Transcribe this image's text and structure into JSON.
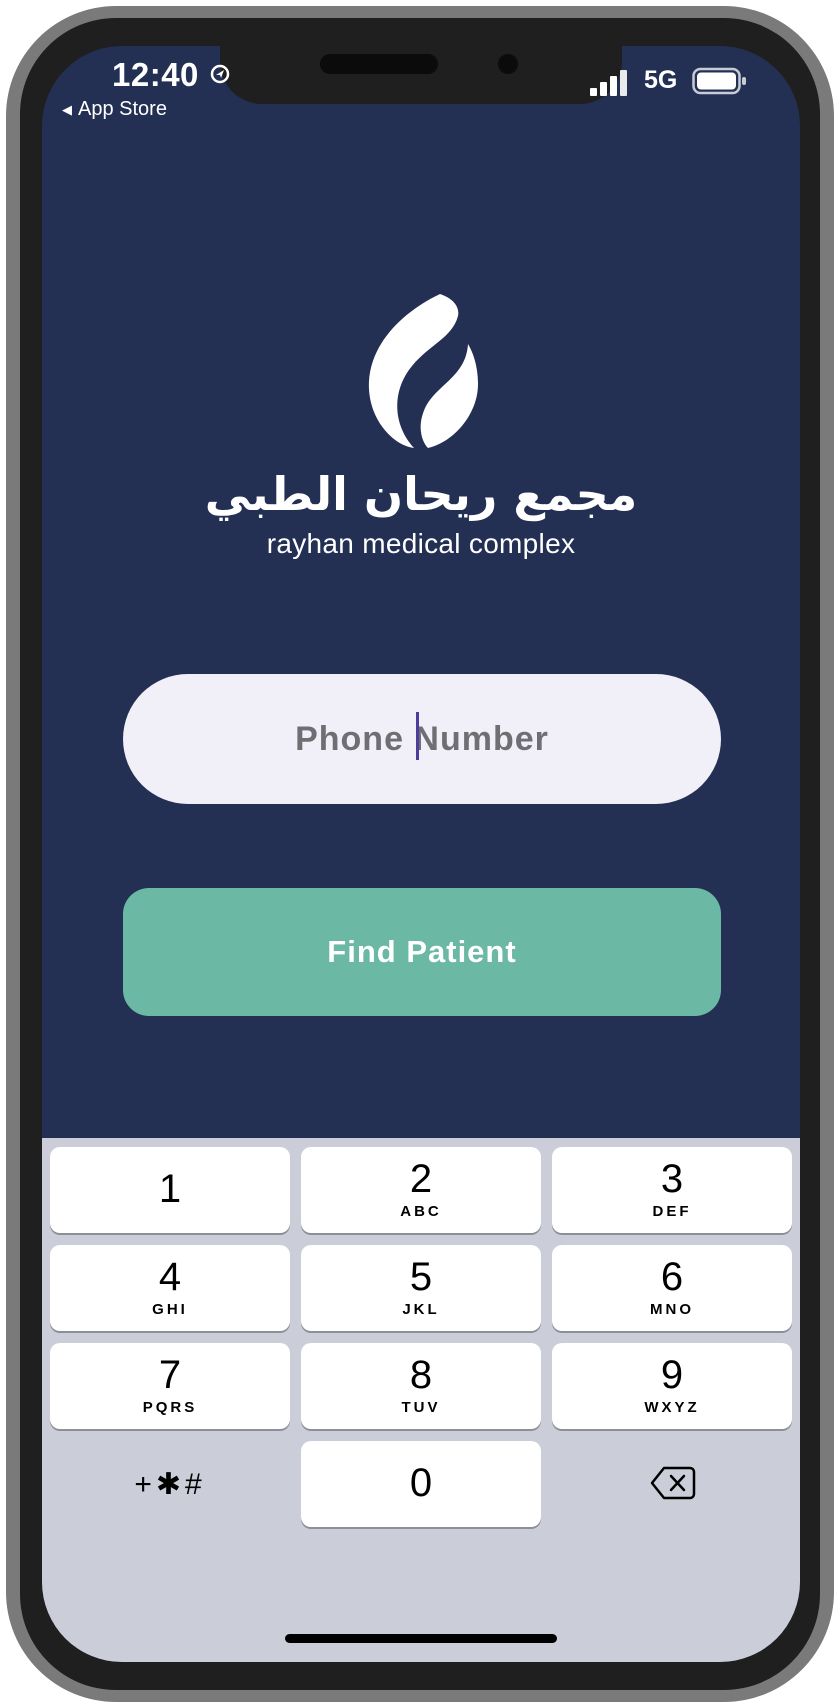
{
  "status_bar": {
    "time": "12:40",
    "back_label": "App Store",
    "network": "5G",
    "icons": [
      "location-icon",
      "signal-icon",
      "battery-icon"
    ]
  },
  "brand": {
    "arabic_name": "مجمع ريحان الطبي",
    "english_name": "rayhan medical complex",
    "logo_icon": "leaf-flame-logo"
  },
  "form": {
    "phone_placeholder": "Phone Number",
    "submit_label": "Find Patient"
  },
  "keypad": {
    "keys": [
      {
        "digit": "1",
        "letters": ""
      },
      {
        "digit": "2",
        "letters": "ABC"
      },
      {
        "digit": "3",
        "letters": "DEF"
      },
      {
        "digit": "4",
        "letters": "GHI"
      },
      {
        "digit": "5",
        "letters": "JKL"
      },
      {
        "digit": "6",
        "letters": "MNO"
      },
      {
        "digit": "7",
        "letters": "PQRS"
      },
      {
        "digit": "8",
        "letters": "TUV"
      },
      {
        "digit": "9",
        "letters": "WXYZ"
      },
      {
        "digit": "0",
        "letters": ""
      }
    ],
    "symbols_label": "+✱#",
    "delete_icon": "backspace-icon"
  },
  "colors": {
    "background": "#233053",
    "input_fill": "#f1eff7",
    "button_fill": "#6bb8a4",
    "keypad_fill": "#cbced8",
    "caret": "#4d3d9a"
  }
}
